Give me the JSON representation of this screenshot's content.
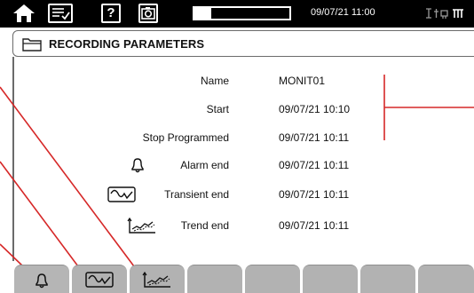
{
  "status_bar": {
    "datetime": "09/07/21 11:00",
    "recording_progress_fraction": 0.18,
    "icons": [
      "home-icon",
      "list-check-icon",
      "help-icon",
      "camera-icon",
      "power-network-icon"
    ]
  },
  "panel": {
    "icon": "folder-icon",
    "title": "RECORDING PARAMETERS"
  },
  "rows": [
    {
      "label": "Name",
      "value": "MONIT01"
    },
    {
      "label": "Start",
      "value": "09/07/21 10:10"
    },
    {
      "label": "Stop Programmed",
      "value": "09/07/21 10:11"
    },
    {
      "label": "Alarm end",
      "value": "09/07/21 10:11",
      "icon": "bell-icon"
    },
    {
      "label": "Transient end",
      "value": "09/07/21 10:11",
      "icon": "transient-wave-icon"
    },
    {
      "label": "Trend end",
      "value": "09/07/21 10:11",
      "icon": "trend-curve-icon"
    }
  ],
  "tabs": [
    {
      "icon": "bell-icon"
    },
    {
      "icon": "transient-wave-icon"
    },
    {
      "icon": "trend-curve-icon"
    },
    {
      "icon": ""
    },
    {
      "icon": ""
    },
    {
      "icon": ""
    },
    {
      "icon": ""
    },
    {
      "icon": ""
    }
  ],
  "colors": {
    "topbar_bg": "#000000",
    "callout": "#d62828",
    "tab_bg": "#b2b2b2"
  }
}
